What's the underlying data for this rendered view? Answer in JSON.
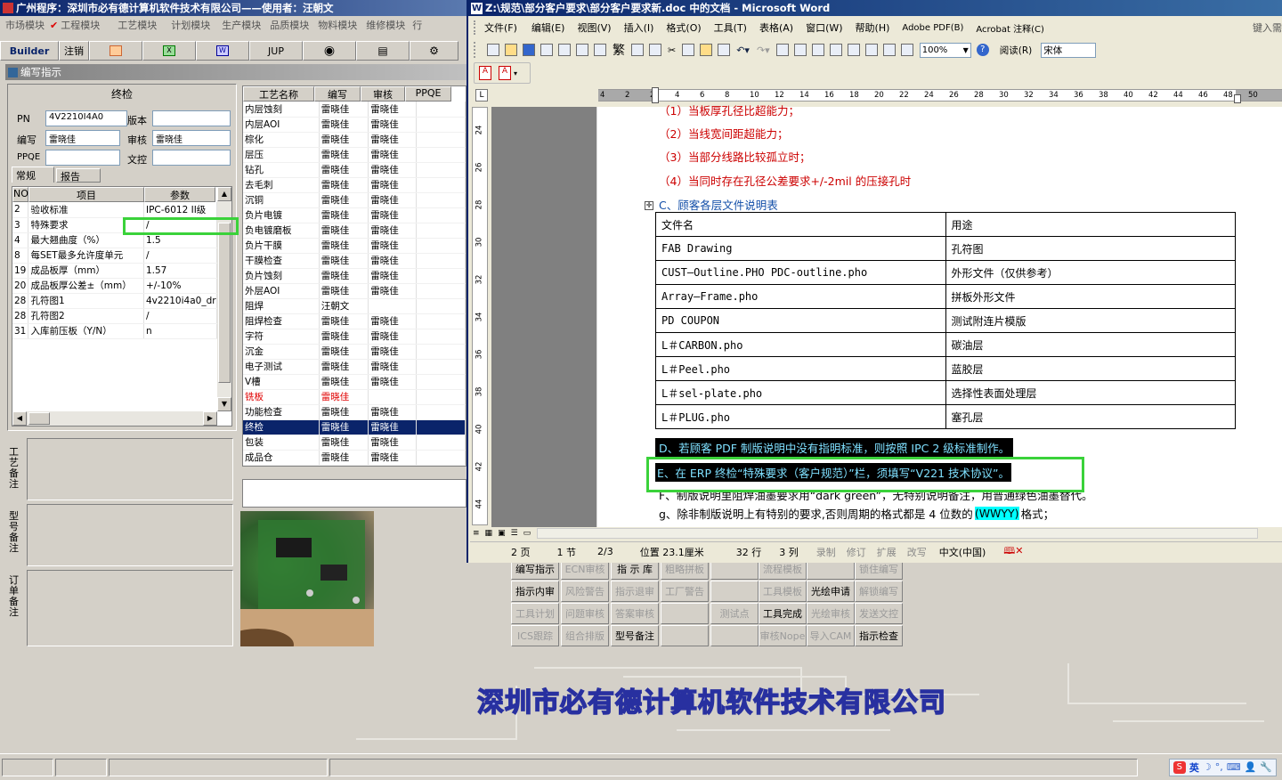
{
  "erp": {
    "title": "广州程序：深圳市必有德计算机软件技术有限公司——使用者：汪朝文",
    "modules": [
      "市场模块",
      "工程模块",
      "工艺模块",
      "计划模块",
      "生产模块",
      "品质模块",
      "物料模块",
      "维修模块",
      "行"
    ],
    "toolbar": {
      "builder": "Builder",
      "logout": "注销",
      "jup": "JUP"
    },
    "panel_title": "编写指示",
    "section": "终检",
    "pn_label": "PN",
    "pn_value": "4V2210I4A0",
    "version_label": "版本",
    "version_value": "",
    "writer_label": "编写",
    "writer_value": "雷晓佳",
    "reviewer_label": "审核",
    "reviewer_value": "雷晓佳",
    "ppqe_label": "PPQE",
    "ppqe_value": "",
    "wenkong_label": "文控",
    "wenkong_value": "",
    "tabs": [
      "常规",
      "报告"
    ],
    "params_headers": [
      "NO",
      "项目",
      "参数"
    ],
    "params": [
      {
        "no": "2",
        "item": "验收标准",
        "value": "IPC-6012 II级"
      },
      {
        "no": "3",
        "item": "特殊要求",
        "value": "/"
      },
      {
        "no": "4",
        "item": "最大翘曲度（%）",
        "value": "1.5"
      },
      {
        "no": "8",
        "item": "每SET最多允许度单元",
        "value": "/"
      },
      {
        "no": "19",
        "item": "成品板厚（mm）",
        "value": "1.57"
      },
      {
        "no": "20",
        "item": "成品板厚公差±（mm）",
        "value": "+/-10%"
      },
      {
        "no": "28",
        "item": "孔符图1",
        "value": "4v2210i4a0_dr"
      },
      {
        "no": "28",
        "item": "孔符图2",
        "value": "/"
      },
      {
        "no": "31",
        "item": "入库前压板（Y/N）",
        "value": "n"
      }
    ],
    "remarks": [
      "工艺备注",
      "型号备注",
      "订单备注"
    ],
    "process_headers": [
      "工艺名称",
      "编写",
      "审核",
      "PPQE"
    ],
    "processes": [
      {
        "name": "内层蚀刻",
        "writer": "雷晓佳",
        "reviewer": "雷晓佳"
      },
      {
        "name": "内层AOI",
        "writer": "雷晓佳",
        "reviewer": "雷晓佳"
      },
      {
        "name": "棕化",
        "writer": "雷晓佳",
        "reviewer": "雷晓佳"
      },
      {
        "name": "层压",
        "writer": "雷晓佳",
        "reviewer": "雷晓佳"
      },
      {
        "name": "钻孔",
        "writer": "雷晓佳",
        "reviewer": "雷晓佳"
      },
      {
        "name": "去毛刺",
        "writer": "雷晓佳",
        "reviewer": "雷晓佳"
      },
      {
        "name": "沉铜",
        "writer": "雷晓佳",
        "reviewer": "雷晓佳"
      },
      {
        "name": "负片电镀",
        "writer": "雷晓佳",
        "reviewer": "雷晓佳"
      },
      {
        "name": "负电镀磨板",
        "writer": "雷晓佳",
        "reviewer": "雷晓佳"
      },
      {
        "name": "负片干膜",
        "writer": "雷晓佳",
        "reviewer": "雷晓佳"
      },
      {
        "name": "干膜检查",
        "writer": "雷晓佳",
        "reviewer": "雷晓佳"
      },
      {
        "name": "负片蚀刻",
        "writer": "雷晓佳",
        "reviewer": "雷晓佳"
      },
      {
        "name": "外层AOI",
        "writer": "雷晓佳",
        "reviewer": "雷晓佳"
      },
      {
        "name": "阻焊",
        "writer": "汪朝文",
        "reviewer": ""
      },
      {
        "name": "阻焊检查",
        "writer": "雷晓佳",
        "reviewer": "雷晓佳"
      },
      {
        "name": "字符",
        "writer": "雷晓佳",
        "reviewer": "雷晓佳"
      },
      {
        "name": "沉金",
        "writer": "雷晓佳",
        "reviewer": "雷晓佳"
      },
      {
        "name": "电子测试",
        "writer": "雷晓佳",
        "reviewer": "雷晓佳"
      },
      {
        "name": "V槽",
        "writer": "雷晓佳",
        "reviewer": "雷晓佳"
      },
      {
        "name": "铣板",
        "writer": "雷晓佳",
        "reviewer": ""
      },
      {
        "name": "功能检查",
        "writer": "雷晓佳",
        "reviewer": "雷晓佳"
      },
      {
        "name": "终检",
        "writer": "雷晓佳",
        "reviewer": "雷晓佳"
      },
      {
        "name": "包装",
        "writer": "雷晓佳",
        "reviewer": "雷晓佳"
      },
      {
        "name": "成品仓",
        "writer": "雷晓佳",
        "reviewer": "雷晓佳"
      }
    ],
    "buttons": [
      [
        "编写指示",
        "ECN审核",
        "指 示 库",
        "粗略拼板",
        "",
        "流程模板",
        "",
        "锁住编写"
      ],
      [
        "指示内审",
        "风险警告",
        "指示退审",
        "工厂警告",
        "",
        "工具模板",
        "光绘申请",
        "解锁编写"
      ],
      [
        "工具计划",
        "问题审核",
        "答案审核",
        "",
        "测试点",
        "工具完成",
        "光绘审核",
        "发送文控"
      ],
      [
        "ICS跟踪",
        "组合排版",
        "型号备注",
        "",
        "",
        "审核Nope",
        "导入CAM",
        "指示检查"
      ]
    ],
    "company_banner": "深圳市必有德计算机软件技术有限公司"
  },
  "word": {
    "title": "Z:\\规范\\部分客户要求\\部分客户要求新.doc 中的文档 - Microsoft Word",
    "help_prompt": "键入需",
    "menu": [
      "文件(F)",
      "编辑(E)",
      "视图(V)",
      "插入(I)",
      "格式(O)",
      "工具(T)",
      "表格(A)",
      "窗口(W)",
      "帮助(H)",
      "Adobe PDF(B)",
      "Acrobat 注释(C)"
    ],
    "zoom": "100%",
    "read_btn": "阅读(R)",
    "font": "宋体",
    "ruler_numbers": [
      "4",
      "2",
      "2",
      "4",
      "6",
      "8",
      "10",
      "12",
      "14",
      "16",
      "18",
      "20",
      "22",
      "24",
      "26",
      "28",
      "30",
      "32",
      "34",
      "36",
      "38",
      "40",
      "42",
      "44",
      "46",
      "48",
      "50"
    ],
    "vruler_numbers": [
      "24",
      "26",
      "28",
      "30",
      "32",
      "34",
      "36",
      "38",
      "40",
      "42",
      "44"
    ],
    "lines_top": [
      "（1）当板厚孔径比超能力；",
      "（2）当线宽间距超能力；",
      "（3）当部分线路比较孤立时；",
      "（4）当同时存在孔径公差要求+/-2mil 的压接孔时"
    ],
    "section_c": "C、顾客各层文件说明表",
    "table_headers": [
      "文件名",
      "用途"
    ],
    "table_rows": [
      [
        "FAB Drawing",
        "孔符图"
      ],
      [
        "CUST—Outline.PHO    PDC-outline.pho",
        "外形文件（仅供参考）"
      ],
      [
        "Array—Frame.pho",
        "拼板外形文件"
      ],
      [
        "PD COUPON",
        "测试附连片模版"
      ],
      [
        "L＃CARBON.pho",
        "碳油层"
      ],
      [
        "L＃Peel.pho",
        "蓝胶层"
      ],
      [
        "L＃sel-plate.pho",
        "选择性表面处理层"
      ],
      [
        "L＃PLUG.pho",
        "塞孔层"
      ]
    ],
    "line_d": "D、若顾客 PDF 制版说明中没有指明标准，则按照 IPC 2 级标准制作。",
    "line_e": "E、在 ERP 终检“特殊要求（客户规范）”栏，须填写“V221 技术协议”。",
    "line_f": "F、制版说明里阻焊油墨要求用“dark green”，无特别说明备注，用普通绿色油墨替代。",
    "line_g_pre": "g、除非制版说明上有特别的要求,否则周期的格式都是 4 位数的",
    "line_g_hl": "(WWYY)",
    "line_g_post": "格式；",
    "status": [
      "2 页",
      "1 节",
      "2/3",
      "位置 23.1厘米",
      "32 行",
      "3 列",
      "录制",
      "修订",
      "扩展",
      "改写",
      "中文(中国)"
    ]
  },
  "taskbar": {
    "ime": "英"
  }
}
